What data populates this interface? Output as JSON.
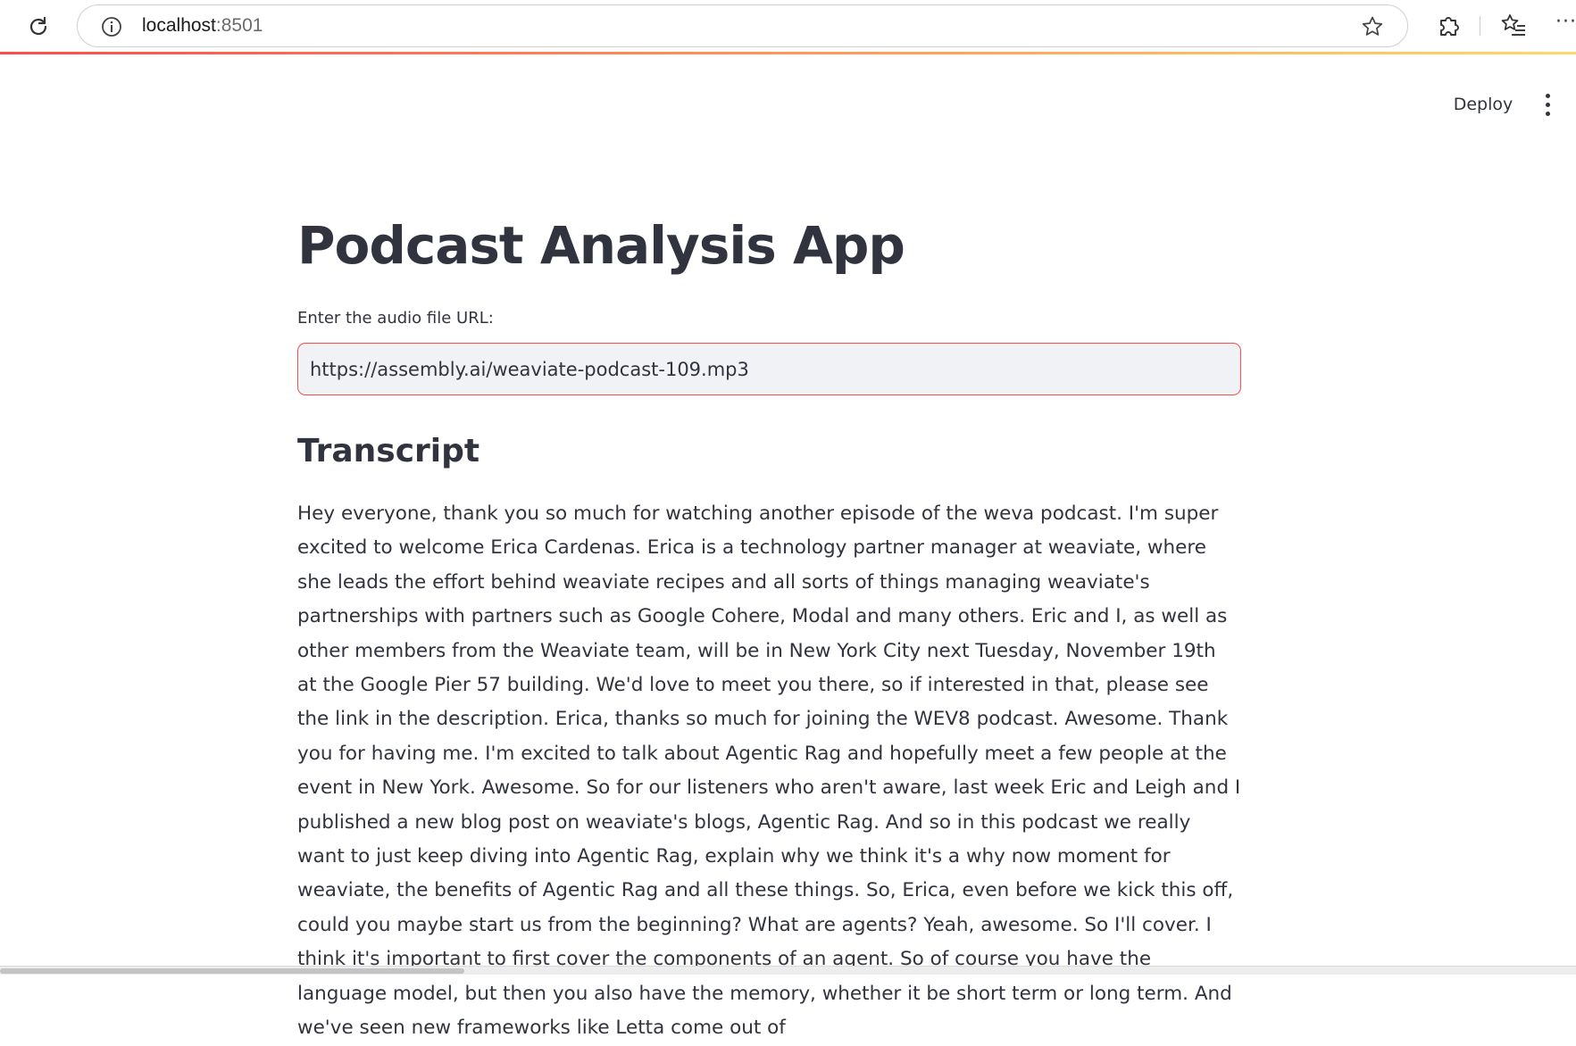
{
  "browser": {
    "url_host": "localhost",
    "url_port": ":8501",
    "icons": {
      "reload": "reload-icon",
      "info": "info-icon",
      "favorite": "star-icon",
      "extensions": "puzzle-icon",
      "favorites": "favorites-icon",
      "more": "more-icon"
    },
    "more_glyph": "···"
  },
  "header": {
    "deploy_label": "Deploy",
    "menu_icon": "kebab-menu-icon"
  },
  "main": {
    "title": "Podcast Analysis App",
    "url_field": {
      "label": "Enter the audio file URL:",
      "value": "https://assembly.ai/weaviate-podcast-109.mp3"
    },
    "transcript_heading": "Transcript",
    "transcript_text": "Hey everyone, thank you so much for watching another episode of the weva podcast. I'm super excited to welcome Erica Cardenas. Erica is a technology partner manager at weaviate, where she leads the effort behind weaviate recipes and all sorts of things managing weaviate's partnerships with partners such as Google Cohere, Modal and many others. Eric and I, as well as other members from the Weaviate team, will be in New York City next Tuesday, November 19th at the Google Pier 57 building. We'd love to meet you there, so if interested in that, please see the link in the description. Erica, thanks so much for joining the WEV8 podcast. Awesome. Thank you for having me. I'm excited to talk about Agentic Rag and hopefully meet a few people at the event in New York. Awesome. So for our listeners who aren't aware, last week Eric and Leigh and I published a new blog post on weaviate's blogs, Agentic Rag. And so in this podcast we really want to just keep diving into Agentic Rag, explain why we think it's a why now moment for weaviate, the benefits of Agentic Rag and all these things. So, Erica, even before we kick this off, could you maybe start us from the beginning? What are agents? Yeah, awesome. So I'll cover. I think it's important to first cover the components of an agent. So of course you have the language model, but then you also have the memory, whether it be short term or long term. And we've seen new frameworks like Letta come out of"
  },
  "colors": {
    "text": "#31333f",
    "accent": "#ff4b4b",
    "input_bg": "#f0f2f6"
  }
}
